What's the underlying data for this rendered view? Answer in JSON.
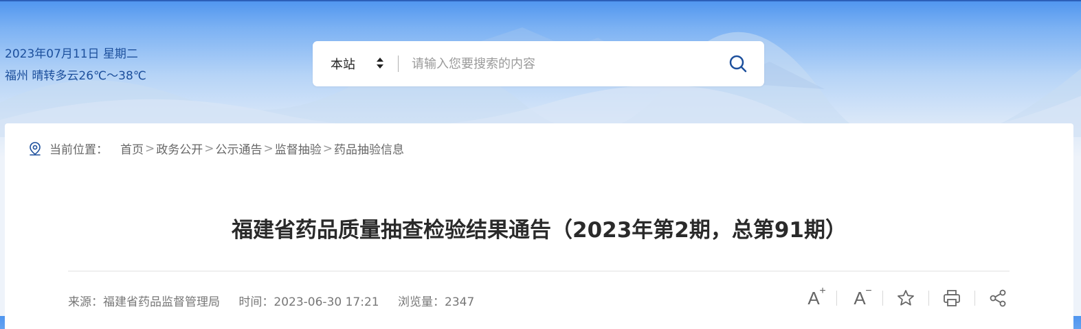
{
  "header": {
    "date": "2023年07月11日",
    "weekday": "星期二",
    "city": "福州",
    "weather": "晴转多云26℃～38℃"
  },
  "search": {
    "scope": "本站",
    "placeholder": "请输入您要搜索的内容"
  },
  "breadcrumb": {
    "label": "当前位置：",
    "items": [
      "首页",
      "政务公开",
      "公示通告",
      "监督抽验",
      "药品抽验信息"
    ]
  },
  "article": {
    "title": "福建省药品质量抽查检验结果通告（2023年第2期，总第91期）",
    "source": "来源：福建省药品监督管理局",
    "time": "时间：2023-06-30 17:21",
    "views": "浏览量：2347"
  },
  "toolbar": {
    "font_increase": "A",
    "font_decrease": "A"
  },
  "colors": {
    "accent": "#1c4f9c",
    "title": "#2a2a2a"
  }
}
